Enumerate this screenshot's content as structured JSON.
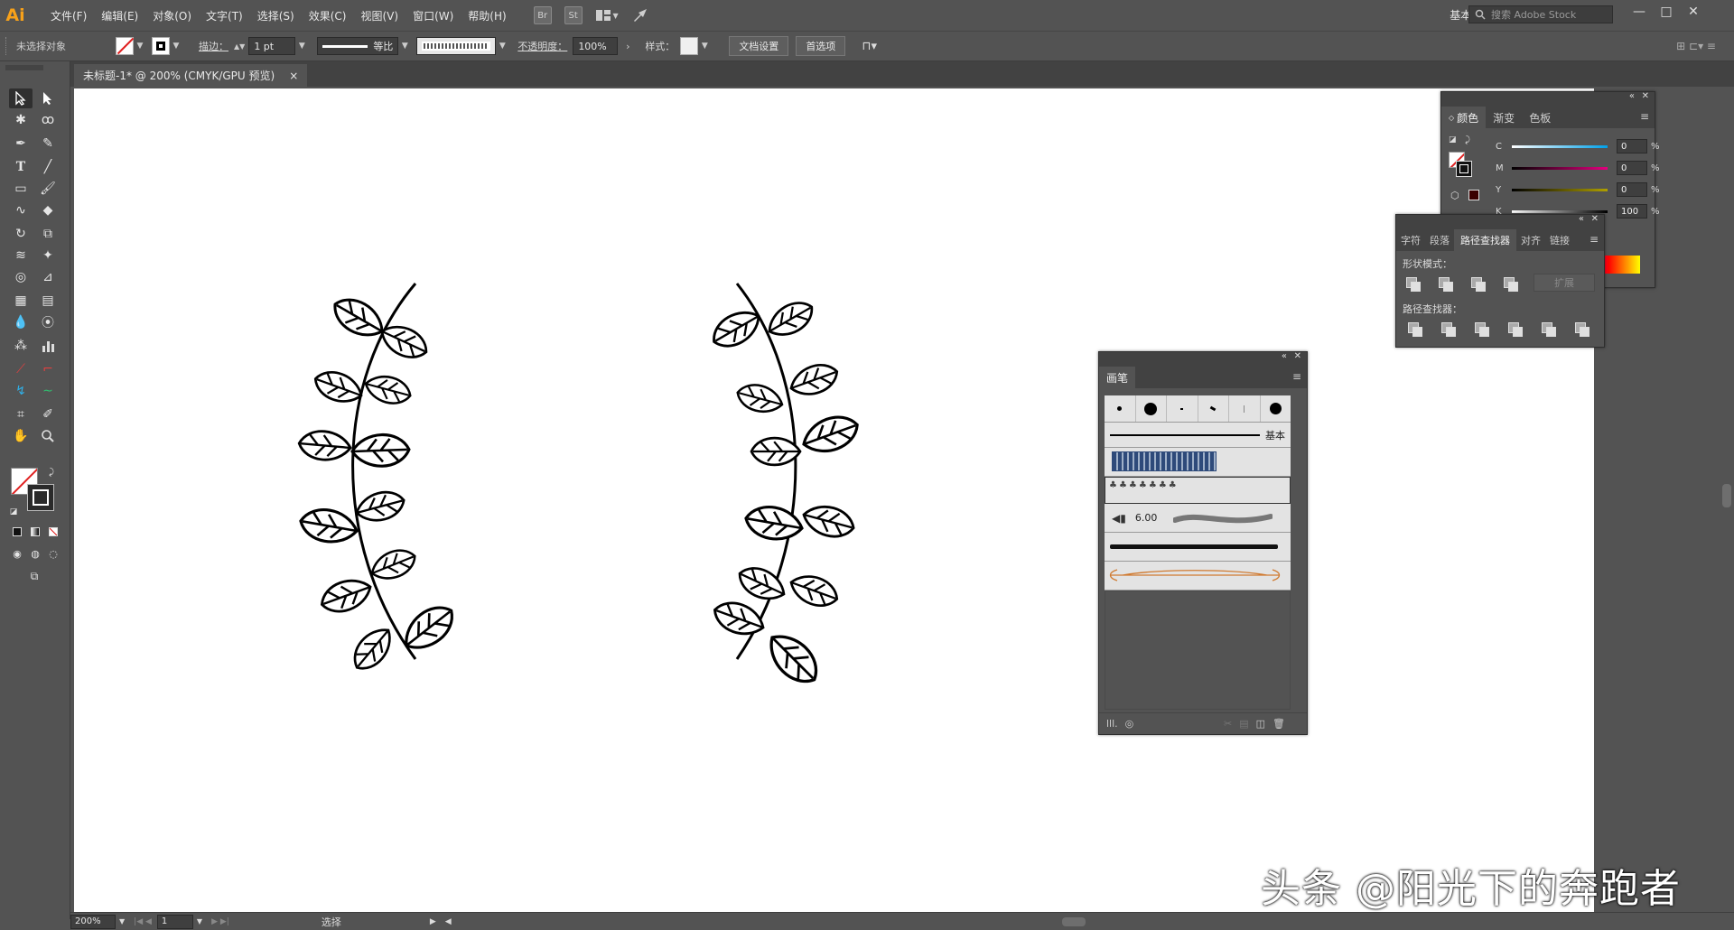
{
  "app": {
    "logo": "Ai"
  },
  "menu": [
    "文件(F)",
    "编辑(E)",
    "对象(O)",
    "文字(T)",
    "选择(S)",
    "效果(C)",
    "视图(V)",
    "窗口(W)",
    "帮助(H)"
  ],
  "menu_icons": {
    "bridge": "Br",
    "stock": "St"
  },
  "workspace": "基本功能",
  "search_placeholder": "搜索 Adobe Stock",
  "controlbar": {
    "selection_status": "未选择对象",
    "stroke_label": "描边：",
    "stroke_weight": "1 pt",
    "stroke_profile": "等比",
    "opacity_label": "不透明度：",
    "opacity_value": "100%",
    "style_label": "样式：",
    "doc_setup": "文档设置",
    "preferences": "首选项"
  },
  "document_tab": {
    "title": "未标题-1* @ 200% (CMYK/GPU 预览)",
    "close": "×"
  },
  "statusbar": {
    "zoom": "200%",
    "artboard": "1",
    "tool": "选择"
  },
  "color_panel": {
    "tabs": [
      "颜色",
      "渐变",
      "色板"
    ],
    "channels": [
      {
        "label": "C",
        "value": "0",
        "pct": "%"
      },
      {
        "label": "M",
        "value": "0",
        "pct": "%"
      },
      {
        "label": "Y",
        "value": "0",
        "pct": "%"
      },
      {
        "label": "K",
        "value": "100",
        "pct": "%"
      }
    ],
    "channel_colors": {
      "C": "#00a0e9",
      "M": "#e4007f",
      "Y": "#fff100",
      "K": "#000000"
    }
  },
  "pathfinder_panel": {
    "tabs": [
      "字符",
      "段落",
      "路径查找器",
      "对齐",
      "链接"
    ],
    "shape_modes_label": "形状模式：",
    "expand_label": "扩展",
    "pathfinders_label": "路径查找器："
  },
  "brushes_panel": {
    "title": "画笔",
    "basic_label": "基本",
    "bristle_size": "6.00"
  },
  "watermark": "头条 @阳光下的奔跑者"
}
